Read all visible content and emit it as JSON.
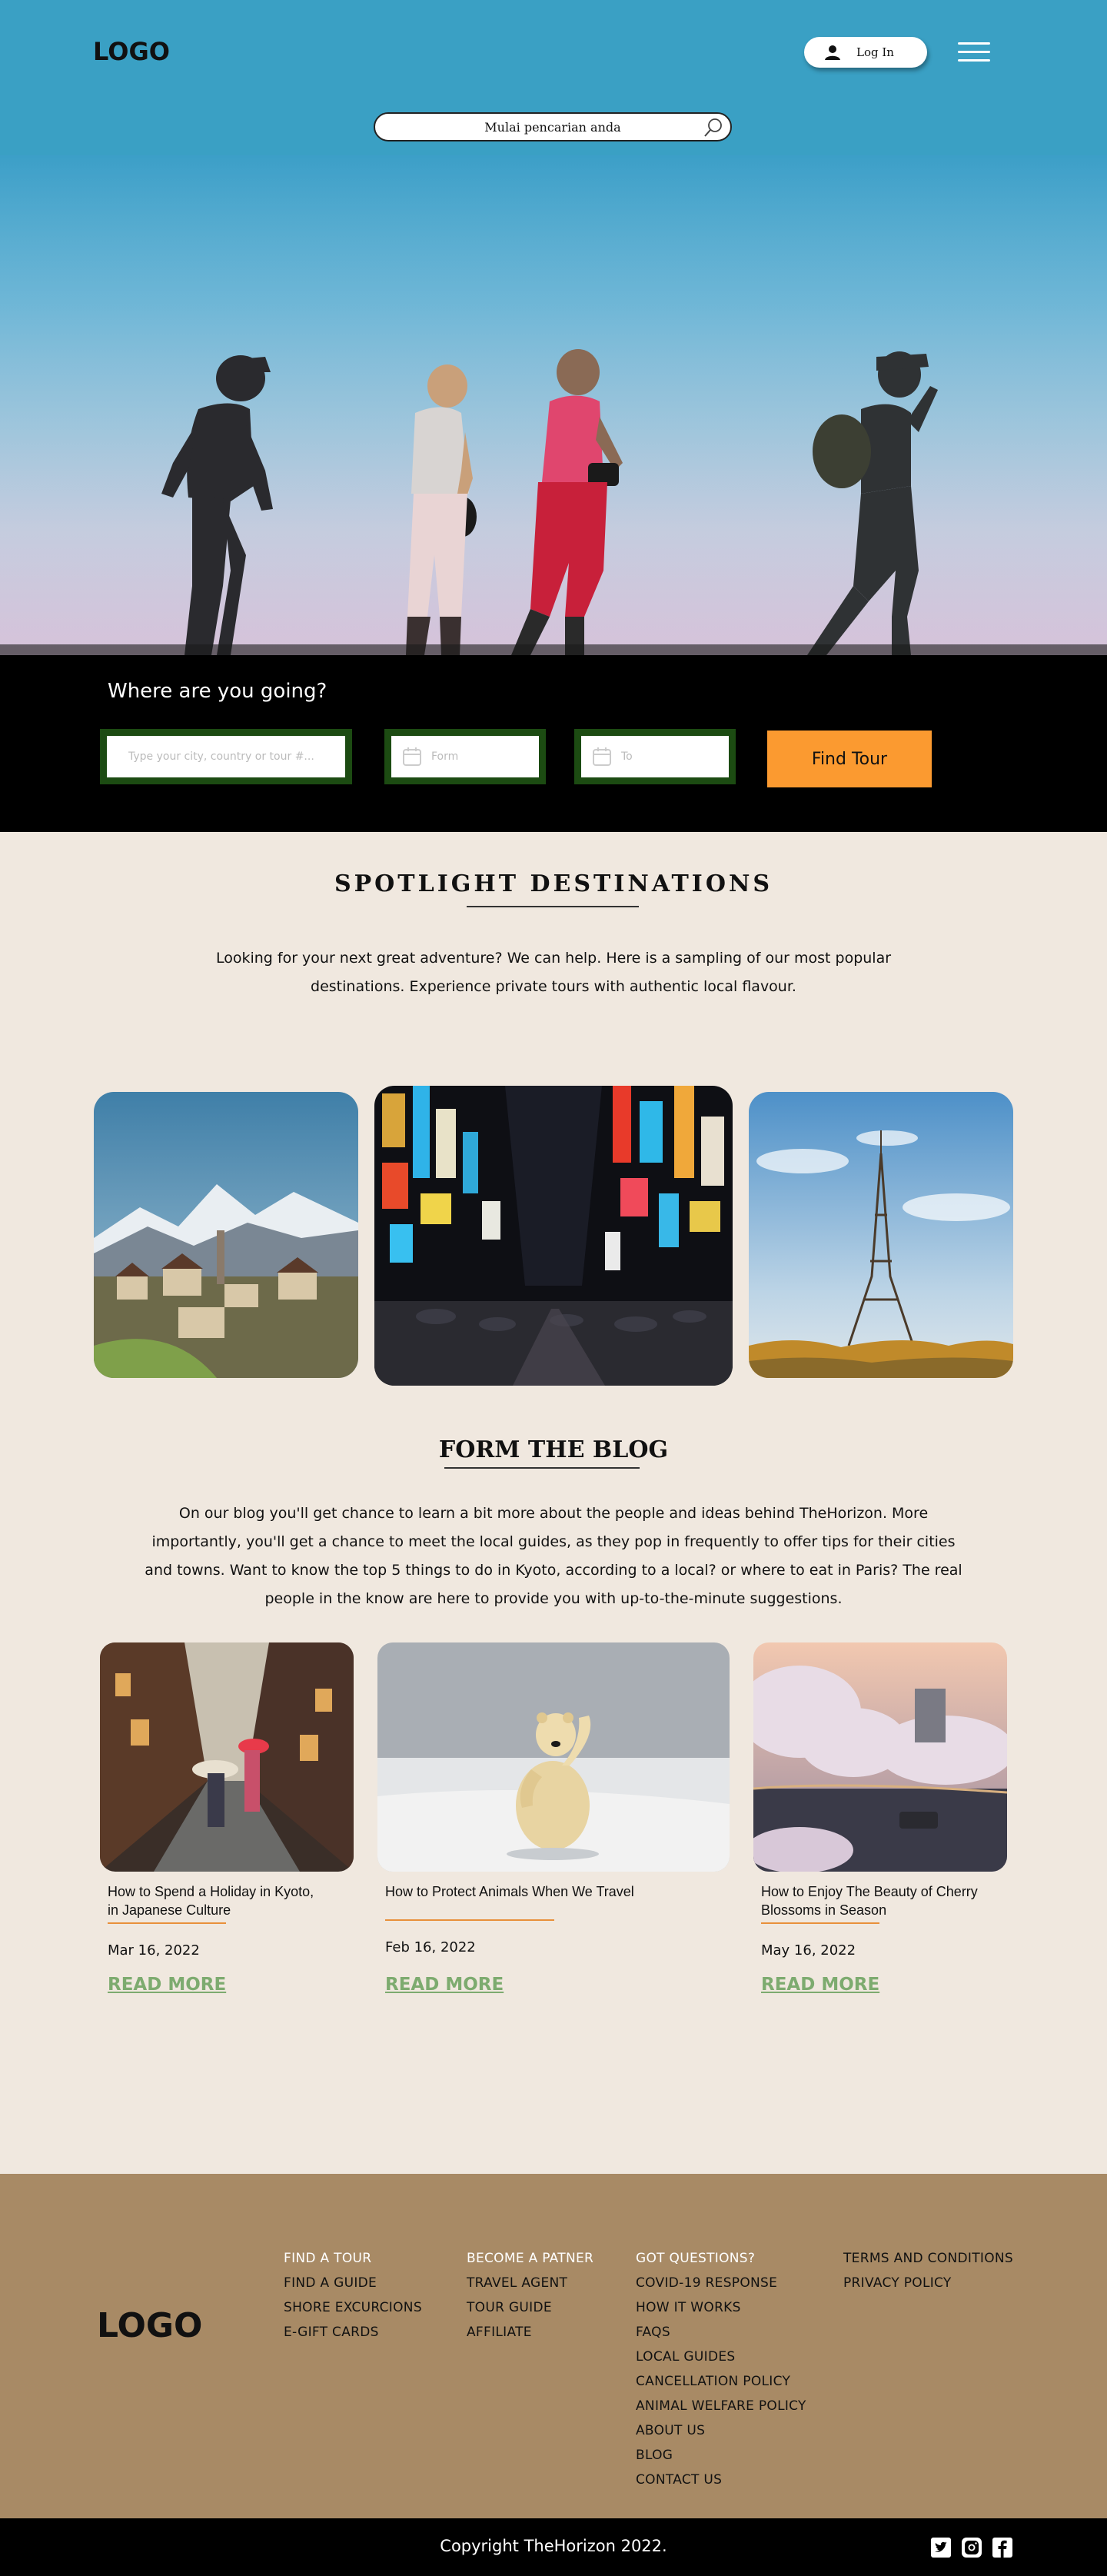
{
  "header": {
    "logo": "LOGO",
    "login_label": "Log In",
    "search_placeholder": "Mulai pencarian anda"
  },
  "tour_search": {
    "heading": "Where are you going?",
    "destination_placeholder": "Type your city, country or tour #...",
    "from_placeholder": "Form",
    "to_placeholder": "To",
    "button": "Find Tour"
  },
  "spotlight": {
    "title": "SPOTLIGHT DESTINATIONS",
    "line1": "Looking for your next great adventure? We can help. Here is a sampling of our most popular",
    "line2": "destinations. Experience private tours with authentic local flavour."
  },
  "blog": {
    "title": "FORM THE BLOG",
    "lines": [
      "On our blog you'll get chance to learn a bit more about the people and ideas behind TheHorizon. More",
      "importantly, you'll get a chance to meet the local guides, as they pop in frequently to offer tips for their cities",
      "and towns. Want to know the top 5 things to do in Kyoto, according to a local? or where to eat in Paris? The real",
      "people in the know are here to provide you with up-to-the-minute suggestions."
    ],
    "posts": [
      {
        "title_1": "How to Spend a Holiday in Kyoto,",
        "title_2": "in Japanese Culture",
        "date": "Mar 16, 2022",
        "more": "READ MORE"
      },
      {
        "title_1": "How to Protect Animals When We Travel",
        "title_2": "",
        "date": "Feb 16, 2022",
        "more": "READ MORE"
      },
      {
        "title_1": "How to Enjoy The Beauty of Cherry",
        "title_2": "Blossoms in Season",
        "date": "May 16, 2022",
        "more": "READ MORE"
      }
    ]
  },
  "footer": {
    "logo": "LOGO",
    "col1": [
      "FIND A TOUR",
      "FIND A GUIDE",
      "SHORE EXCURCIONS",
      "E-GIFT CARDS"
    ],
    "col2": [
      "BECOME A PATNER",
      "TRAVEL AGENT",
      "TOUR GUIDE",
      "AFFILIATE"
    ],
    "col3": [
      "GOT QUESTIONS?",
      "COVID-19 RESPONSE",
      "HOW IT WORKS",
      "FAQS",
      "LOCAL GUIDES",
      "CANCELLATION POLICY",
      "ANIMAL WELFARE POLICY",
      "ABOUT US",
      "BLOG",
      "CONTACT US"
    ],
    "col4": [
      "TERMS AND CONDITIONS",
      "PRIVACY POLICY"
    ],
    "copyright": "Copyright TheHorizon 2022."
  },
  "colors": {
    "header_bg": "#3aa0c4",
    "accent_orange": "#fb9a30",
    "read_more_green": "#7dab6f",
    "footer_bg": "#a88a65",
    "field_border": "#1c4b12",
    "page_bg": "#f0e8df"
  },
  "icons": [
    "user-icon",
    "menu-icon",
    "search-icon",
    "calendar-icon",
    "twitter-icon",
    "instagram-icon",
    "facebook-icon"
  ]
}
